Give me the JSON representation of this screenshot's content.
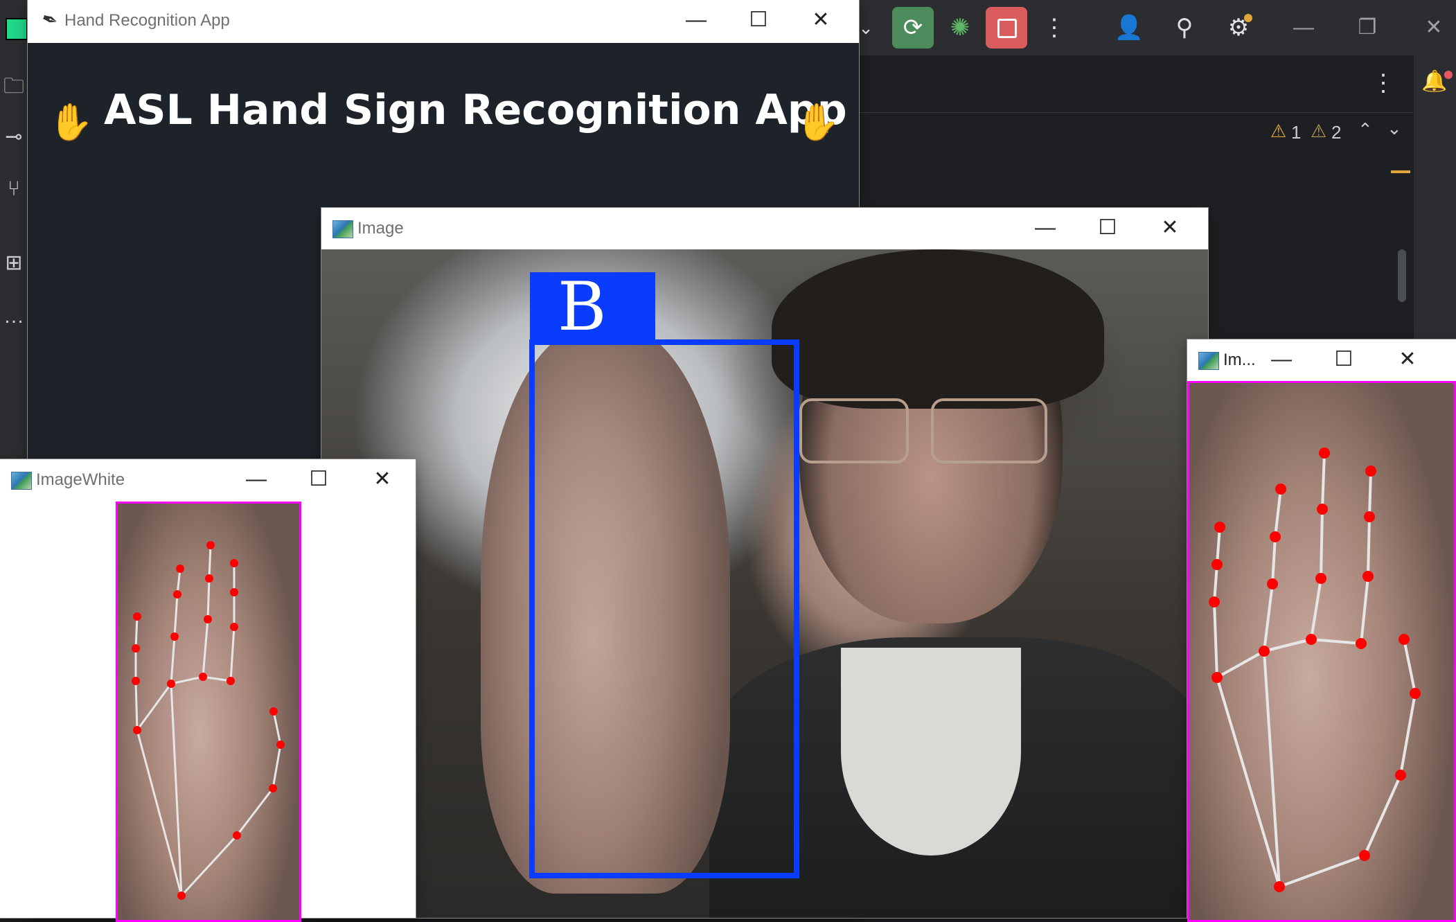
{
  "ide": {
    "toolbar_icons": [
      "chevron-down-icon",
      "run-icon",
      "debug-icon",
      "stop-icon",
      "more-vert-icon",
      "add-user-icon",
      "search-icon",
      "settings-icon"
    ],
    "window_controls": [
      "minimize-icon",
      "restore-icon",
      "close-icon"
    ],
    "inspections": {
      "warnings": "1",
      "weak_warnings": "2"
    },
    "colors": {
      "background": "#1e1f22",
      "panel": "#2b2d30",
      "run_green": "#4b8b5c",
      "stop_red": "#db5c5c",
      "warning": "#e0a63c"
    }
  },
  "app_window": {
    "title": "Hand Recognition App",
    "heading": "ASL Hand Sign Recognition App",
    "heading_left_icon": "✋",
    "heading_right_icon": "✋",
    "background": "#1e2329"
  },
  "image_window": {
    "title": "Image",
    "predicted_letter": "B",
    "box_color": "#0a3cff"
  },
  "crop_window": {
    "title": "Im..."
  },
  "white_window": {
    "title": "ImageWhite"
  },
  "landmarks": {
    "point_color": "#ff0000",
    "line_color": "#e6e6e6",
    "border_color": "#ff00ff"
  }
}
